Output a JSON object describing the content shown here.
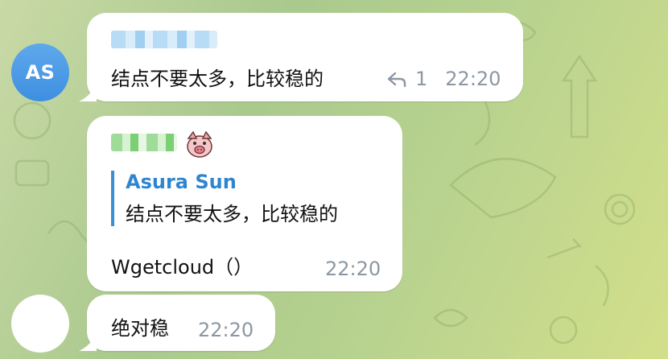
{
  "messages": [
    {
      "avatar_initials": "AS",
      "text": "结点不要太多，比较稳的",
      "reply_count": "1",
      "time": "22:20"
    },
    {
      "reply_to": {
        "name": "Asura Sun",
        "text": "结点不要太多，比较稳的"
      },
      "text": "Wgetcloud（）",
      "time": "22:20",
      "sticker_icon": "pig-emoji"
    },
    {
      "text": "绝对稳",
      "time": "22:20"
    }
  ],
  "colors": {
    "avatar_blue": "#4a9ae6",
    "quote_accent": "#3a8fd6",
    "meta_gray": "#8c97a3"
  }
}
